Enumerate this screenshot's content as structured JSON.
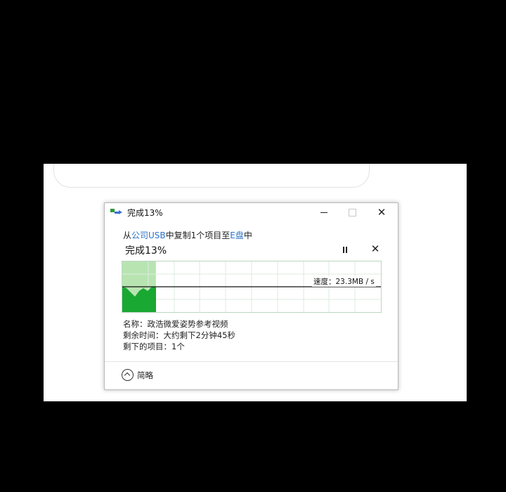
{
  "dialog": {
    "title": "完成13%",
    "from_prefix": "从",
    "source": "公司USB",
    "from_middle": "中复制1个项目至",
    "destination": "E盘",
    "from_suffix": "中",
    "status": "完成13%",
    "progress_percent": 13,
    "speed_label": "速度：23.3MB / s",
    "name_line": "名称：政浩微爱姿势参考视频",
    "time_left_line": "剩余时间：大约剩下2分钟45秒",
    "items_left_line": "剩下的项目：1个",
    "collapse_label": "简略"
  },
  "icons": {
    "title": "copy-transfer-icon",
    "minimize": "minimize-icon",
    "maximize": "maximize-icon",
    "close": "close-icon",
    "pause": "pause-icon",
    "cancel": "cancel-icon",
    "collapse": "chevron-up-icon",
    "keyboard": "keyboard-icon"
  },
  "colors": {
    "progress_fill": "#b8e4b2",
    "speed_fill": "#19a832",
    "link": "#2a72c9"
  }
}
